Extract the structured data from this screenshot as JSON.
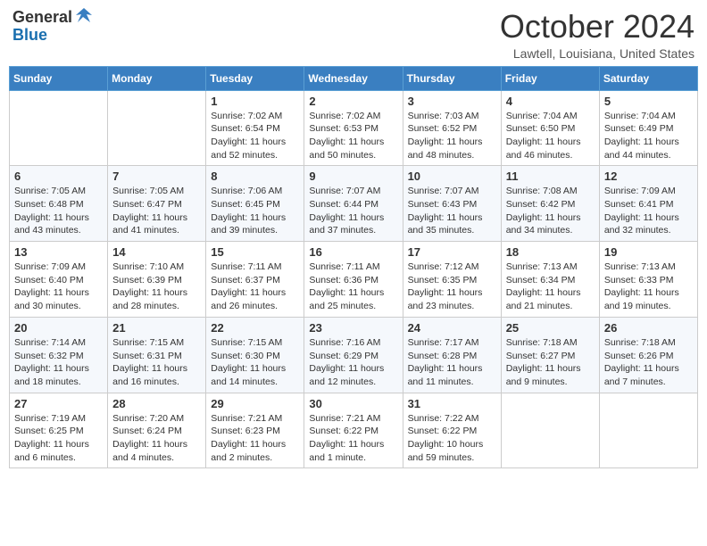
{
  "header": {
    "logo_general": "General",
    "logo_blue": "Blue",
    "month_title": "October 2024",
    "location": "Lawtell, Louisiana, United States"
  },
  "days_of_week": [
    "Sunday",
    "Monday",
    "Tuesday",
    "Wednesday",
    "Thursday",
    "Friday",
    "Saturday"
  ],
  "weeks": [
    [
      {
        "day": "",
        "info": ""
      },
      {
        "day": "",
        "info": ""
      },
      {
        "day": "1",
        "info": "Sunrise: 7:02 AM\nSunset: 6:54 PM\nDaylight: 11 hours and 52 minutes."
      },
      {
        "day": "2",
        "info": "Sunrise: 7:02 AM\nSunset: 6:53 PM\nDaylight: 11 hours and 50 minutes."
      },
      {
        "day": "3",
        "info": "Sunrise: 7:03 AM\nSunset: 6:52 PM\nDaylight: 11 hours and 48 minutes."
      },
      {
        "day": "4",
        "info": "Sunrise: 7:04 AM\nSunset: 6:50 PM\nDaylight: 11 hours and 46 minutes."
      },
      {
        "day": "5",
        "info": "Sunrise: 7:04 AM\nSunset: 6:49 PM\nDaylight: 11 hours and 44 minutes."
      }
    ],
    [
      {
        "day": "6",
        "info": "Sunrise: 7:05 AM\nSunset: 6:48 PM\nDaylight: 11 hours and 43 minutes."
      },
      {
        "day": "7",
        "info": "Sunrise: 7:05 AM\nSunset: 6:47 PM\nDaylight: 11 hours and 41 minutes."
      },
      {
        "day": "8",
        "info": "Sunrise: 7:06 AM\nSunset: 6:45 PM\nDaylight: 11 hours and 39 minutes."
      },
      {
        "day": "9",
        "info": "Sunrise: 7:07 AM\nSunset: 6:44 PM\nDaylight: 11 hours and 37 minutes."
      },
      {
        "day": "10",
        "info": "Sunrise: 7:07 AM\nSunset: 6:43 PM\nDaylight: 11 hours and 35 minutes."
      },
      {
        "day": "11",
        "info": "Sunrise: 7:08 AM\nSunset: 6:42 PM\nDaylight: 11 hours and 34 minutes."
      },
      {
        "day": "12",
        "info": "Sunrise: 7:09 AM\nSunset: 6:41 PM\nDaylight: 11 hours and 32 minutes."
      }
    ],
    [
      {
        "day": "13",
        "info": "Sunrise: 7:09 AM\nSunset: 6:40 PM\nDaylight: 11 hours and 30 minutes."
      },
      {
        "day": "14",
        "info": "Sunrise: 7:10 AM\nSunset: 6:39 PM\nDaylight: 11 hours and 28 minutes."
      },
      {
        "day": "15",
        "info": "Sunrise: 7:11 AM\nSunset: 6:37 PM\nDaylight: 11 hours and 26 minutes."
      },
      {
        "day": "16",
        "info": "Sunrise: 7:11 AM\nSunset: 6:36 PM\nDaylight: 11 hours and 25 minutes."
      },
      {
        "day": "17",
        "info": "Sunrise: 7:12 AM\nSunset: 6:35 PM\nDaylight: 11 hours and 23 minutes."
      },
      {
        "day": "18",
        "info": "Sunrise: 7:13 AM\nSunset: 6:34 PM\nDaylight: 11 hours and 21 minutes."
      },
      {
        "day": "19",
        "info": "Sunrise: 7:13 AM\nSunset: 6:33 PM\nDaylight: 11 hours and 19 minutes."
      }
    ],
    [
      {
        "day": "20",
        "info": "Sunrise: 7:14 AM\nSunset: 6:32 PM\nDaylight: 11 hours and 18 minutes."
      },
      {
        "day": "21",
        "info": "Sunrise: 7:15 AM\nSunset: 6:31 PM\nDaylight: 11 hours and 16 minutes."
      },
      {
        "day": "22",
        "info": "Sunrise: 7:15 AM\nSunset: 6:30 PM\nDaylight: 11 hours and 14 minutes."
      },
      {
        "day": "23",
        "info": "Sunrise: 7:16 AM\nSunset: 6:29 PM\nDaylight: 11 hours and 12 minutes."
      },
      {
        "day": "24",
        "info": "Sunrise: 7:17 AM\nSunset: 6:28 PM\nDaylight: 11 hours and 11 minutes."
      },
      {
        "day": "25",
        "info": "Sunrise: 7:18 AM\nSunset: 6:27 PM\nDaylight: 11 hours and 9 minutes."
      },
      {
        "day": "26",
        "info": "Sunrise: 7:18 AM\nSunset: 6:26 PM\nDaylight: 11 hours and 7 minutes."
      }
    ],
    [
      {
        "day": "27",
        "info": "Sunrise: 7:19 AM\nSunset: 6:25 PM\nDaylight: 11 hours and 6 minutes."
      },
      {
        "day": "28",
        "info": "Sunrise: 7:20 AM\nSunset: 6:24 PM\nDaylight: 11 hours and 4 minutes."
      },
      {
        "day": "29",
        "info": "Sunrise: 7:21 AM\nSunset: 6:23 PM\nDaylight: 11 hours and 2 minutes."
      },
      {
        "day": "30",
        "info": "Sunrise: 7:21 AM\nSunset: 6:22 PM\nDaylight: 11 hours and 1 minute."
      },
      {
        "day": "31",
        "info": "Sunrise: 7:22 AM\nSunset: 6:22 PM\nDaylight: 10 hours and 59 minutes."
      },
      {
        "day": "",
        "info": ""
      },
      {
        "day": "",
        "info": ""
      }
    ]
  ]
}
